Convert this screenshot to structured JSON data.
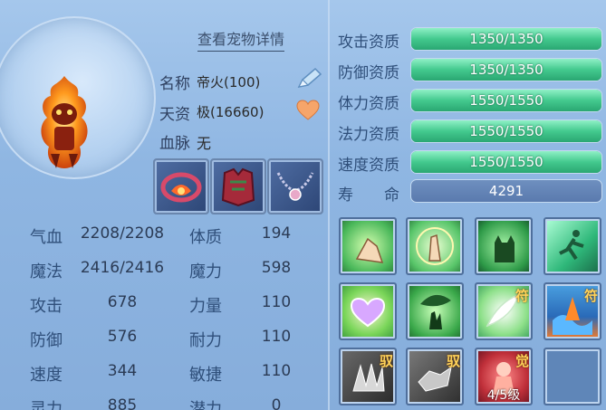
{
  "detail_link": "查看宠物详情",
  "info": {
    "name_label": "名称",
    "name_value": "帝火(100)",
    "talent_label": "天资",
    "talent_value": "极(16660)",
    "blood_label": "血脉",
    "blood_value": "无"
  },
  "stats": [
    {
      "label": "气血",
      "value": "2208/2208",
      "label2": "体质",
      "value2": "194"
    },
    {
      "label": "魔法",
      "value": "2416/2416",
      "label2": "魔力",
      "value2": "598"
    },
    {
      "label": "攻击",
      "value": "678",
      "label2": "力量",
      "value2": "110"
    },
    {
      "label": "防御",
      "value": "576",
      "label2": "耐力",
      "value2": "110"
    },
    {
      "label": "速度",
      "value": "344",
      "label2": "敏捷",
      "value2": "110"
    },
    {
      "label": "灵力",
      "value": "885",
      "label2": "潜力",
      "value2": "0"
    }
  ],
  "aptitudes": [
    {
      "label": "攻击资质",
      "text": "1350/1350",
      "fill": 1.0
    },
    {
      "label": "防御资质",
      "text": "1350/1350",
      "fill": 1.0
    },
    {
      "label": "体力资质",
      "text": "1550/1550",
      "fill": 1.0
    },
    {
      "label": "法力资质",
      "text": "1550/1550",
      "fill": 1.0
    },
    {
      "label": "速度资质",
      "text": "1550/1550",
      "fill": 1.0
    }
  ],
  "life": {
    "label": "寿　　命",
    "value": "4291"
  },
  "skills": {
    "badge_yu": "驭",
    "badge_fu": "符",
    "badge_jue": "觉",
    "level_text": "4/5级"
  },
  "colors": {
    "bar_fill": "#43c98e",
    "bar_bg": "#5a7da6",
    "accent": "#2f4f7a"
  }
}
